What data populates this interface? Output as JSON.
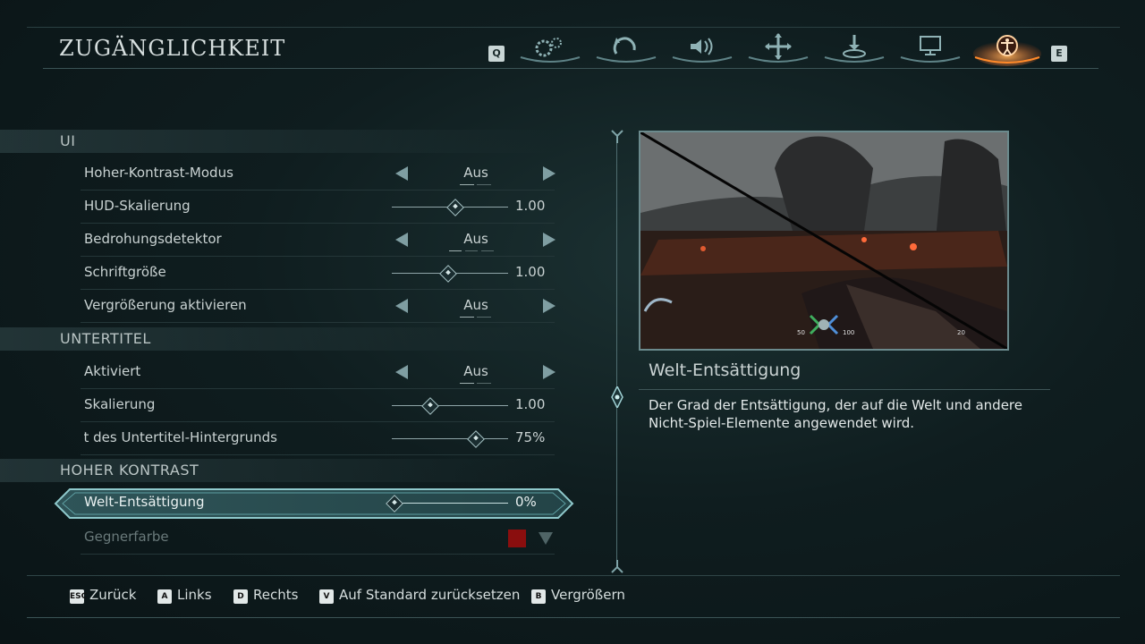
{
  "header": {
    "title": "ZUGÄNGLICHKEIT",
    "key_prev": "Q",
    "key_next": "E",
    "tabs": [
      {
        "icon": "gears-icon",
        "active": false
      },
      {
        "icon": "controller-rotate-icon",
        "active": false
      },
      {
        "icon": "speaker-icon",
        "active": false
      },
      {
        "icon": "move-cross-icon",
        "active": false
      },
      {
        "icon": "download-icon",
        "active": false
      },
      {
        "icon": "monitor-icon",
        "active": false
      },
      {
        "icon": "accessibility-icon",
        "active": true
      }
    ]
  },
  "sections": {
    "ui": {
      "label": "UI",
      "rows": [
        {
          "label": "Hoher-Kontrast-Modus",
          "type": "toggle",
          "value": "Aus"
        },
        {
          "label": "HUD-Skalierung",
          "type": "slider",
          "value": "1.00",
          "fraction": 0.55
        },
        {
          "label": "Bedrohungsdetektor",
          "type": "toggle",
          "value": "Aus"
        },
        {
          "label": "Schriftgröße",
          "type": "slider",
          "value": "1.00",
          "fraction": 0.48
        },
        {
          "label": "Vergrößerung aktivieren",
          "type": "toggle",
          "value": "Aus"
        }
      ]
    },
    "subtitles": {
      "label": "UNTERTITEL",
      "rows": [
        {
          "label": "Aktiviert",
          "type": "toggle",
          "value": "Aus"
        },
        {
          "label": "Skalierung",
          "type": "slider",
          "value": "1.00",
          "fraction": 0.33
        },
        {
          "label": "Deckkraft des Untertitel-Hintergrunds",
          "type": "slider",
          "value": "75%",
          "fraction": 0.71
        }
      ]
    },
    "high_contrast": {
      "label": "HOHER KONTRAST",
      "rows": [
        {
          "label": "Welt-Entsättigung",
          "type": "slider",
          "value": "0%",
          "fraction": 0.0,
          "selected": true
        },
        {
          "label": "Gegnerfarbe",
          "type": "color",
          "color": "#8a0e0e",
          "disabled": true
        }
      ]
    }
  },
  "detail": {
    "title": "Welt-Entsättigung",
    "description": "Der Grad der Entsättigung, der auf die Welt und andere Nicht-Spiel-Elemente angewendet wird.",
    "hud": {
      "left_value": "50",
      "right_value": "100",
      "ammo": "20"
    }
  },
  "footer": [
    {
      "key": "ESC",
      "label": "Zurück"
    },
    {
      "key": "A",
      "label": "Links"
    },
    {
      "key": "D",
      "label": "Rechts"
    },
    {
      "key": "V",
      "label": "Auf Standard zurücksetzen"
    },
    {
      "key": "B",
      "label": "Vergrößern"
    }
  ],
  "colors": {
    "accent": "#e87a2a",
    "frame": "#3b5355",
    "enemy_color": "#8a0e0e"
  }
}
